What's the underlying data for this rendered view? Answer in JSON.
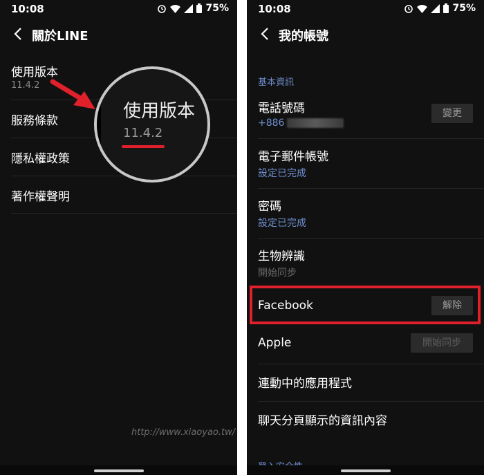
{
  "left": {
    "status": {
      "time": "10:08",
      "battery": "75%"
    },
    "header": {
      "title": "關於LINE"
    },
    "rows": [
      {
        "title": "使用版本",
        "subtitle": "11.4.2"
      },
      {
        "title": "服務條款"
      },
      {
        "title": "隱私權政策"
      },
      {
        "title": "著作權聲明"
      }
    ],
    "magnifier": {
      "title": "使用版本",
      "version": "11.4.2"
    }
  },
  "right": {
    "status": {
      "time": "10:08",
      "battery": "75%"
    },
    "header": {
      "title": "我的帳號"
    },
    "section_basic": "基本資訊",
    "phone": {
      "title": "電話號碼",
      "value": "+886",
      "button": "變更"
    },
    "email": {
      "title": "電子郵件帳號",
      "value": "設定已完成"
    },
    "password": {
      "title": "密碼",
      "value": "設定已完成"
    },
    "biometric": {
      "title": "生物辨識",
      "value": "開始同步"
    },
    "facebook": {
      "title": "Facebook",
      "button": "解除"
    },
    "apple": {
      "title": "Apple",
      "button": "開始同步"
    },
    "linked_apps": {
      "title": "連動中的應用程式"
    },
    "chat_tab": {
      "title": "聊天分頁顯示的資訊內容"
    },
    "section_login": "登入安全性"
  },
  "watermark": "http://www.xiaoyao.tw/",
  "colors": {
    "background": "#111111",
    "accent_blue": "#6f8fd0",
    "highlight_red": "#e0202a"
  }
}
